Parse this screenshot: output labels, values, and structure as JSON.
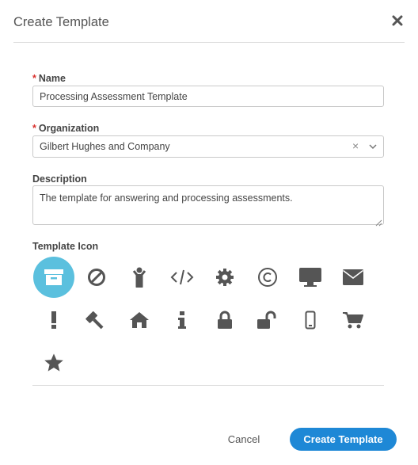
{
  "dialog": {
    "title": "Create Template",
    "close_icon": "close-icon"
  },
  "form": {
    "required_marker": "*",
    "name": {
      "label": "Name",
      "value": "Processing Assessment Template"
    },
    "organization": {
      "label": "Organization",
      "value": "Gilbert Hughes and Company",
      "clear_glyph": "×"
    },
    "description": {
      "label": "Description",
      "value": "The template for answering and processing assessments."
    },
    "template_icon": {
      "label": "Template Icon",
      "selected": "archive-icon",
      "icons": [
        "archive-icon",
        "ban-icon",
        "child-icon",
        "code-icon",
        "gear-icon",
        "copyright-icon",
        "desktop-icon",
        "envelope-icon",
        "exclamation-icon",
        "gavel-icon",
        "home-icon",
        "info-icon",
        "lock-icon",
        "unlock-icon",
        "mobile-icon",
        "cart-icon",
        "star-icon"
      ]
    }
  },
  "footer": {
    "cancel_label": "Cancel",
    "create_label": "Create Template"
  },
  "colors": {
    "accent": "#1e88d6",
    "selected_icon_bg": "#5bc0de",
    "required": "#d9302c",
    "icon": "#555555"
  }
}
